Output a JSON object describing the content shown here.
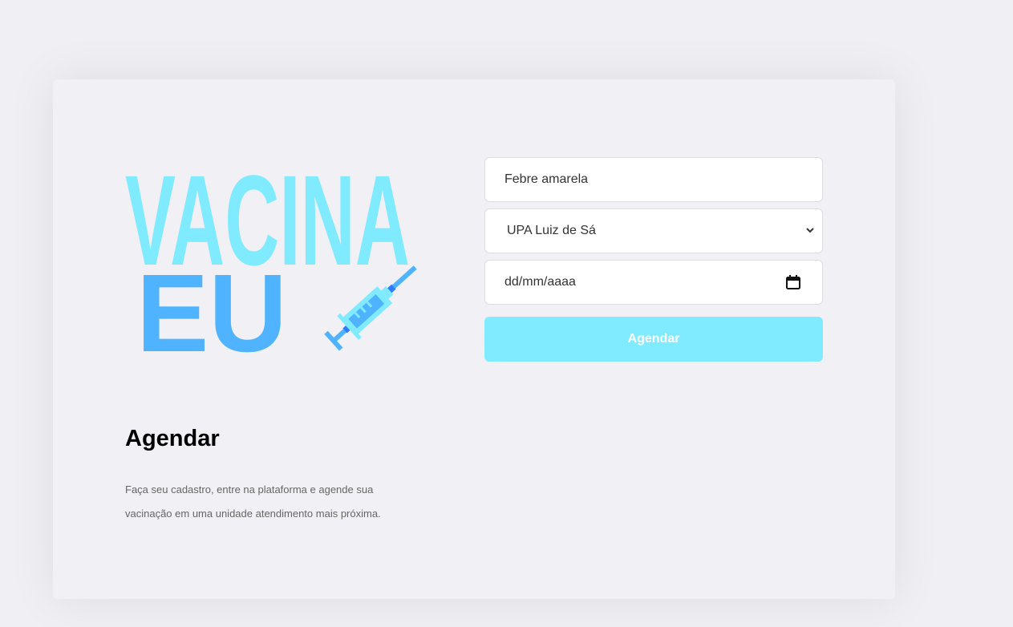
{
  "logo": {
    "line1": "VACINA",
    "line2": "EU",
    "color_primary": "#80ebff",
    "color_secondary": "#4fb3ff",
    "icon": "syringe-icon"
  },
  "intro": {
    "title": "Agendar",
    "description": "Faça seu cadastro, entre na plataforma e agende sua vacinação em uma unidade atendimento mais próxima."
  },
  "form": {
    "vaccine_value": "Febre amarela",
    "unit_selected": "UPA Luiz de Sá",
    "date_placeholder": "dd/mm/aaaa",
    "submit_label": "Agendar",
    "accent": "#80ebff"
  }
}
